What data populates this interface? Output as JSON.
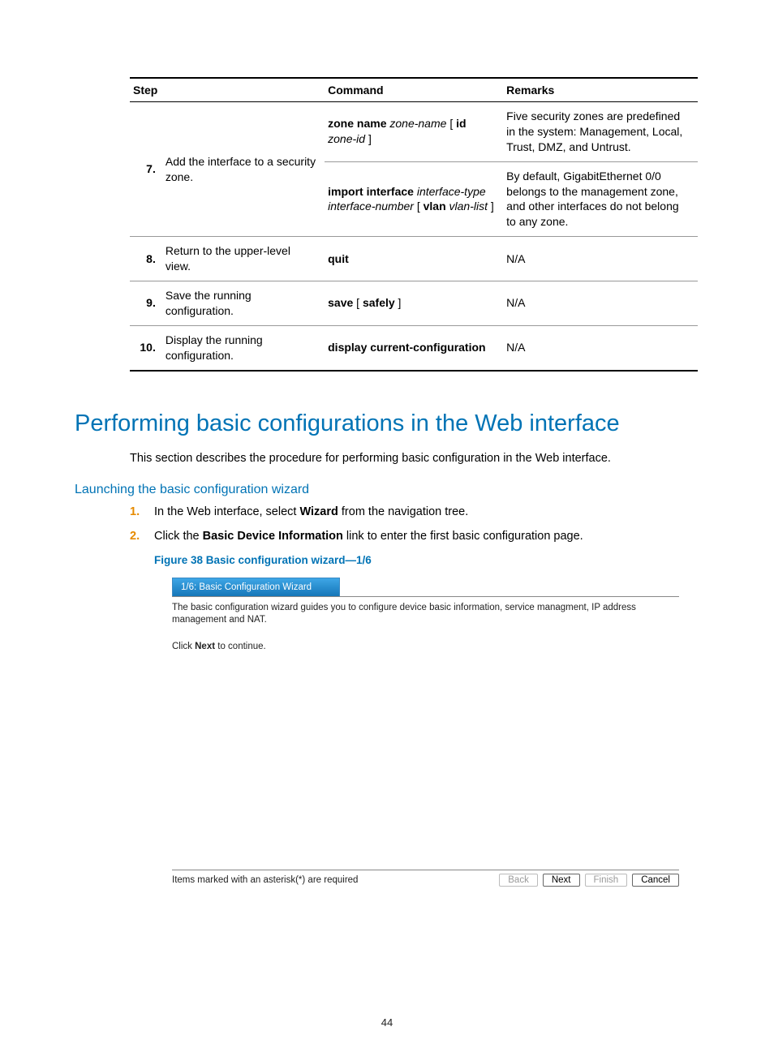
{
  "table": {
    "headers": {
      "step": "Step",
      "command": "Command",
      "remarks": "Remarks"
    },
    "rows": [
      {
        "num": "7.",
        "desc": "Add the interface to a security zone.",
        "sub": [
          {
            "cmd_b1": "zone name",
            "cmd_i1": " zone-name ",
            "cmd_p1": "[ ",
            "cmd_b2": "id",
            "cmd_i2": " zone-id ",
            "cmd_p2": "]",
            "remark": "Five security zones are predefined in the system: Management, Local, Trust, DMZ, and Untrust."
          },
          {
            "cmd_b1": "import interface",
            "cmd_i1": " interface-type interface-number ",
            "cmd_p1": "[ ",
            "cmd_b2": "vlan",
            "cmd_i2": " vlan-list ",
            "cmd_p2": "]",
            "remark": "By default, GigabitEthernet 0/0 belongs to the management zone, and other interfaces do not belong to any zone."
          }
        ]
      },
      {
        "num": "8.",
        "desc": "Return to the upper-level view.",
        "cmd_b1": "quit",
        "remark": "N/A"
      },
      {
        "num": "9.",
        "desc": "Save the running configuration.",
        "cmd_b1": "save",
        "cmd_p1": " [ ",
        "cmd_b2": "safely",
        "cmd_p2": " ]",
        "remark": "N/A"
      },
      {
        "num": "10.",
        "desc": "Display the running configuration.",
        "cmd_b1": "display current-configuration",
        "remark": "N/A"
      }
    ]
  },
  "h1": "Performing basic configurations in the Web interface",
  "intro": "This section describes the procedure for performing basic configuration in the Web interface.",
  "h3": "Launching the basic configuration wizard",
  "list": [
    {
      "num": "1.",
      "t1": "In the Web interface, select ",
      "b": "Wizard",
      "t2": " from the navigation tree."
    },
    {
      "num": "2.",
      "t1": "Click the ",
      "b": "Basic Device Information",
      "t2": " link to enter the first basic configuration page."
    }
  ],
  "figcap": "Figure 38 Basic configuration wizard—1/6",
  "wizard": {
    "tab": "1/6: Basic Configuration Wizard",
    "desc": "The basic configuration wizard guides you to configure device basic information, service managment, IP address management and NAT.",
    "cont1": "Click ",
    "cont_b": "Next",
    "cont2": " to continue.",
    "required": "Items marked with an asterisk(*) are required",
    "btn_back": "Back",
    "btn_next": "Next",
    "btn_finish": "Finish",
    "btn_cancel": "Cancel"
  },
  "pagenum": "44"
}
